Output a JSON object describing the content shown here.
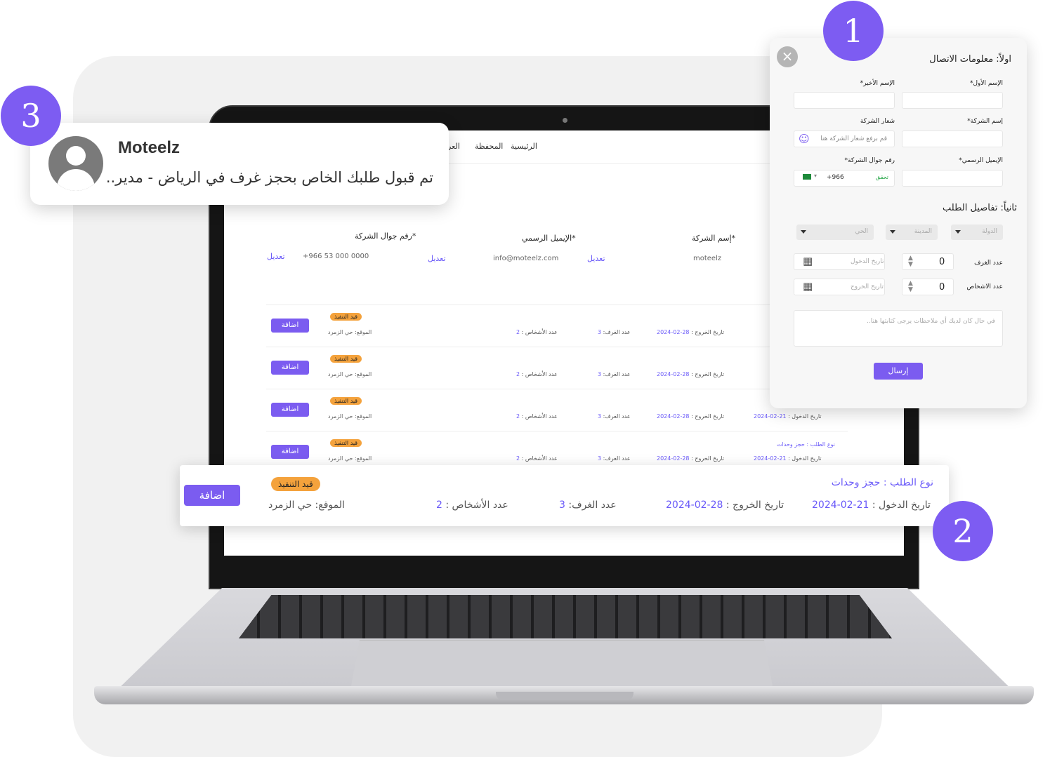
{
  "steps": [
    "1",
    "2",
    "3"
  ],
  "nav": {
    "items": [
      "الرئيسية",
      "المحفظة",
      "العر"
    ]
  },
  "company": {
    "name_label": "إسم الشركة*",
    "name_value": "moteelz",
    "email_label": "الإيميل الرسمي*",
    "email_value": "info@moteelz.com",
    "phone_label": "رقم جوال الشركة*",
    "phone_value": "+966 53 000 0000",
    "edit_label": "تعديل"
  },
  "order": {
    "add_label": "اضافة",
    "status": "قيد التنفيذ",
    "location": "الموقع: حي الزمرد",
    "persons_label": "عدد الأشخاص :",
    "persons": "2",
    "rooms_label": "عدد الغرف:",
    "rooms": "3",
    "checkout_label": "تاريخ الخروج :",
    "checkout": "28-02-2024",
    "checkin_label": "تاريخ الدخول :",
    "checkin": "21-02-2024",
    "type": "نوع الطلب : حجز وحدات"
  },
  "notification": {
    "title": "Moteelz",
    "message": "تم قبول طلبك الخاص بحجز غرف في الرياض - مدير.."
  },
  "form": {
    "section1": "اولاً: معلومات الاتصال",
    "first_name": "الإسم الأول*",
    "last_name": "الإسم الأخير*",
    "company_name": "إسم الشركة*",
    "company_logo": "شعار الشركة",
    "logo_upload": "قم برفع شعار الشركة هنا",
    "email": "الإيميل الرسمي*",
    "phone": "رقم جوال الشركة*",
    "phone_code": "+966",
    "verify": "تحقق",
    "section2": "ثانياً: تفاصيل الطلب",
    "country": "الدولة",
    "city": "المدينة",
    "district": "الحي",
    "rooms_label": "عدد الغرف",
    "persons_label": "عدد الاشخاص",
    "zero": "0",
    "checkin_placeholder": "تاريخ الدخول",
    "checkout_placeholder": "تاريخ الخروج",
    "notes_placeholder": "في حال كان لديك أي ملاحظات يرجى كتابتها هنا..",
    "send": "إرسال"
  },
  "colors": {
    "accent": "#7b5cf0",
    "badge": "#f4a23c",
    "step": "#7d5cf2"
  }
}
